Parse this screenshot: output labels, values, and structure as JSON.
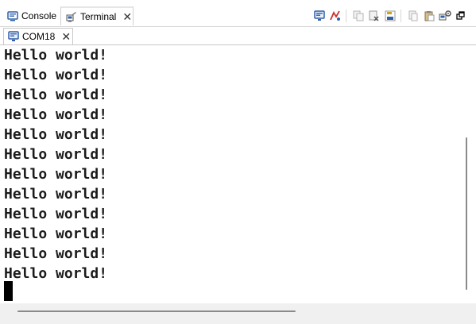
{
  "tabs": [
    {
      "label": "Console",
      "icon": "console-icon"
    },
    {
      "label": "Terminal",
      "icon": "terminal-icon"
    }
  ],
  "toolbar": {
    "buttons": [
      "monitor-icon",
      "disconnect-icon",
      "copy-icon",
      "clear-icon",
      "save-icon",
      "copy-all-icon",
      "paste-icon",
      "settings-icon",
      "minimize-icon"
    ]
  },
  "session_tab": {
    "label": "COM18",
    "icon": "monitor-icon"
  },
  "terminal": {
    "lines": [
      "Hello world!",
      "Hello world!",
      "Hello world!",
      "Hello world!",
      "Hello world!",
      "Hello world!",
      "Hello world!",
      "Hello world!",
      "Hello world!",
      "Hello world!",
      "Hello world!",
      "Hello world!"
    ]
  },
  "colors": {
    "accent": "#2f5fa8",
    "disconnect": "#cc3333"
  }
}
